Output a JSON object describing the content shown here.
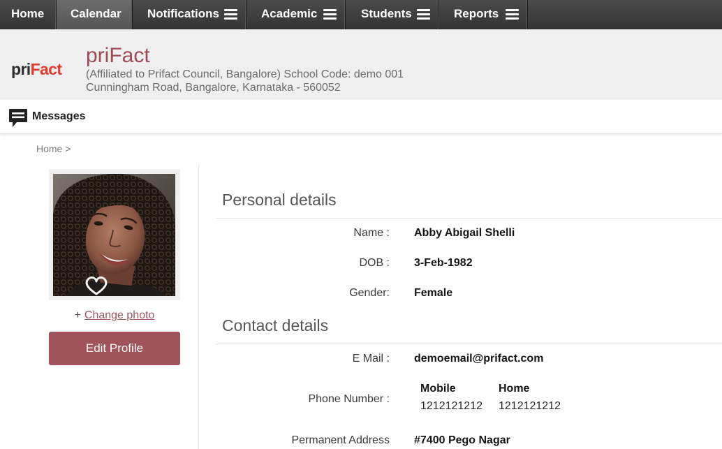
{
  "theme": {
    "nav_bg": "#3d3d3d",
    "nav_active_bg": "#5f5f5f",
    "brand_color": "#9d4b54",
    "button_color": "#a0535b",
    "logo_accent": "#e03a32",
    "link_color": "#9b5660"
  },
  "nav": {
    "items": [
      {
        "label": "Home",
        "active": false,
        "has_menu": false
      },
      {
        "label": "Calendar",
        "active": true,
        "has_menu": false
      },
      {
        "label": "Notifications",
        "active": false,
        "has_menu": true,
        "menu_icon": "hamburger-icon"
      },
      {
        "label": "Academic",
        "active": false,
        "has_menu": true,
        "menu_icon": "hamburger-icon"
      },
      {
        "label": "Students",
        "active": false,
        "has_menu": true,
        "menu_icon": "hamburger-icon"
      },
      {
        "label": "Reports",
        "active": false,
        "has_menu": true,
        "menu_icon": "hamburger-icon"
      }
    ]
  },
  "header": {
    "logo": {
      "part1": "pri",
      "part2": "Fact"
    },
    "title": "priFact",
    "affiliation": "(Affiliated to Prifact Council, Bangalore) School Code: demo 001",
    "address": "Cunningham Road, Bangalore, Karnataka - 560052"
  },
  "messages_bar": {
    "icon": "message-icon",
    "label": "Messages"
  },
  "breadcrumb": {
    "home": "Home",
    "separator": ">"
  },
  "profile": {
    "change_photo_prefix": "+",
    "change_photo_label": "Change photo",
    "edit_label": "Edit Profile"
  },
  "personal_details": {
    "heading": "Personal details",
    "rows": [
      {
        "label": "Name :",
        "value": "Abby Abigail Shelli"
      },
      {
        "label": "DOB :",
        "value": "3-Feb-1982"
      },
      {
        "label": "Gender:",
        "value": "Female"
      }
    ]
  },
  "contact_details": {
    "heading": "Contact details",
    "email": {
      "label": "E Mail :",
      "value": "demoemail@prifact.com"
    },
    "phone": {
      "label": "Phone Number :",
      "columns": [
        {
          "heading": "Mobile",
          "value": "1212121212"
        },
        {
          "heading": "Home",
          "value": "1212121212"
        }
      ]
    },
    "address": {
      "label": "Permanent Address",
      "value": "#7400 Pego Nagar"
    }
  }
}
